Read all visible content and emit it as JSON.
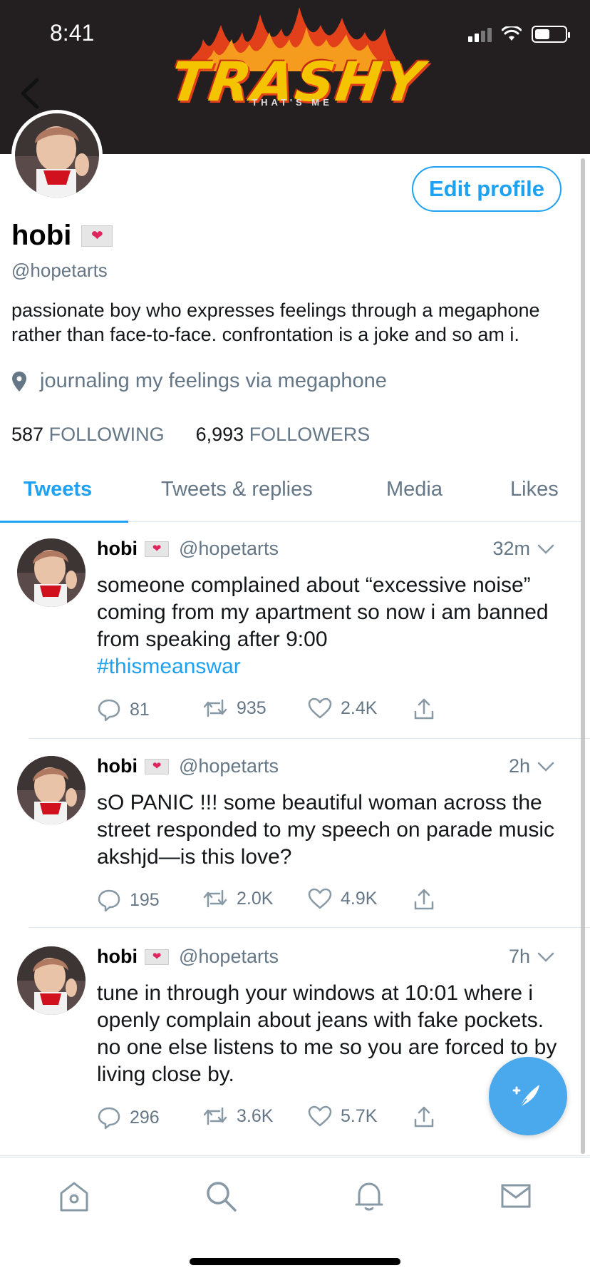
{
  "status_bar": {
    "time": "8:41"
  },
  "banner": {
    "logo_word": "TRASHY",
    "logo_sub": "THAT'S ME",
    "background": "#231f20"
  },
  "profile": {
    "name": "hobi",
    "handle": "@hopetarts",
    "edit_label": "Edit profile",
    "bio": "passionate boy who expresses feelings through a megaphone rather than face-to-face. confrontation is a joke and so am i.",
    "location": "journaling my feelings via megaphone",
    "following_count": "587",
    "following_label": "FOLLOWING",
    "followers_count": "6,993",
    "followers_label": "FOLLOWERS"
  },
  "tabs": [
    {
      "label": "Tweets",
      "active": true
    },
    {
      "label": "Tweets & replies",
      "active": false
    },
    {
      "label": "Media",
      "active": false
    },
    {
      "label": "Likes",
      "active": false
    }
  ],
  "tweets": [
    {
      "name": "hobi",
      "handle": "@hopetarts",
      "time": "32m",
      "text": "someone complained about “excessive noise” coming from my apartment so now i am banned from speaking after 9:00",
      "hashtag": "#thismeanswar",
      "replies": "81",
      "retweets": "935",
      "likes": "2.4K"
    },
    {
      "name": "hobi",
      "handle": "@hopetarts",
      "time": "2h",
      "text": "sO PANIC !!! some beautiful woman across the street responded to my speech on parade music akshjd—is this love?",
      "hashtag": "",
      "replies": "195",
      "retweets": "2.0K",
      "likes": "4.9K"
    },
    {
      "name": "hobi",
      "handle": "@hopetarts",
      "time": "7h",
      "text": "tune in through your windows at 10:01 where i openly complain about jeans with fake pockets. no one else listens to me so you are forced to by living close by.",
      "hashtag": "",
      "replies": "296",
      "retweets": "3.6K",
      "likes": "5.7K"
    }
  ],
  "bottom_nav": [
    "home-icon",
    "search-icon",
    "bell-icon",
    "mail-icon"
  ],
  "colors": {
    "accent": "#1da1f2",
    "muted": "#657786",
    "heart": "#e0245e",
    "fab": "#4aa8ec"
  }
}
